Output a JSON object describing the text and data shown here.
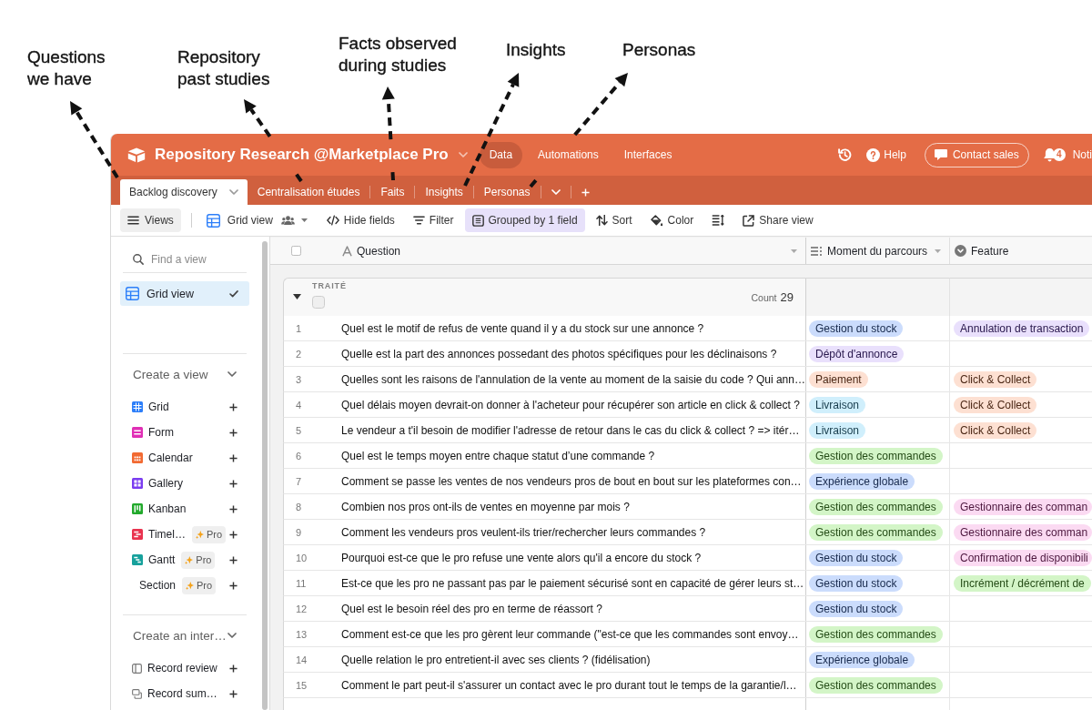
{
  "annotations": [
    {
      "text": "Questions\nwe have"
    },
    {
      "text": "Repository\npast studies"
    },
    {
      "text": "Facts observed\nduring studies"
    },
    {
      "text": "Insights"
    },
    {
      "text": "Personas"
    }
  ],
  "header": {
    "title": "Repository Research @Marketplace Pro",
    "nav": [
      {
        "label": "Data",
        "selected": true
      },
      {
        "label": "Automations",
        "selected": false
      },
      {
        "label": "Interfaces",
        "selected": false
      }
    ],
    "help": "Help",
    "contact_sales": "Contact sales",
    "notification_count": "4",
    "notifications": "Noti"
  },
  "tabs": [
    {
      "label": "Backlog discovery",
      "selected": true
    },
    {
      "label": "Centralisation études",
      "selected": false
    },
    {
      "label": "Faits",
      "selected": false
    },
    {
      "label": "Insights",
      "selected": false
    },
    {
      "label": "Personas",
      "selected": false
    }
  ],
  "toolbar": {
    "views": "Views",
    "view_name": "Grid view",
    "buttons": [
      {
        "kind": "hide",
        "label": "Hide fields",
        "active": false
      },
      {
        "kind": "filter",
        "label": "Filter",
        "active": false
      },
      {
        "kind": "group",
        "label": "Grouped by 1 field",
        "active": true
      },
      {
        "kind": "sort",
        "label": "Sort",
        "active": false
      },
      {
        "kind": "color",
        "label": "Color",
        "active": false
      },
      {
        "kind": "row_height",
        "active": false
      },
      {
        "kind": "share",
        "label": "Share view",
        "active": false
      }
    ]
  },
  "sidebar": {
    "search_placeholder": "Find a view",
    "views": [
      {
        "label": "Grid view",
        "selected": true
      }
    ],
    "sections": [
      {
        "title": "Create a view",
        "expanded": true,
        "items": [
          {
            "kind": "grid",
            "label": "Grid"
          },
          {
            "kind": "form",
            "label": "Form"
          },
          {
            "kind": "calendar",
            "label": "Calendar"
          },
          {
            "kind": "gallery",
            "label": "Gallery"
          },
          {
            "kind": "kanban",
            "label": "Kanban"
          },
          {
            "kind": "timeline",
            "label": "Timel…",
            "badge": "Pro"
          },
          {
            "kind": "gantt",
            "label": "Gantt",
            "badge": "Pro"
          },
          {
            "kind": "section",
            "label": "Section",
            "badge": "Pro"
          }
        ]
      },
      {
        "title": "Create an inter…",
        "expanded": true,
        "items": [
          {
            "kind": "record_review",
            "label": "Record review"
          },
          {
            "kind": "record_summary",
            "label": "Record sum…"
          }
        ]
      }
    ]
  },
  "table": {
    "select_all": {
      "checked": false
    },
    "columns": [
      {
        "kind": "text",
        "label": "Question"
      },
      {
        "kind": "multi_select",
        "label": "Moment du parcours"
      },
      {
        "kind": "single_select",
        "label": "Feature"
      }
    ],
    "group": {
      "field": "TRAITÉ",
      "checked": false,
      "expanded": true,
      "count_label": "Count",
      "count": "29"
    },
    "rows": [
      {
        "number": "1",
        "question": "Quel est le motif de refus de vente quand il y a du stock sur une annonce ?",
        "moment": {
          "label": "Gestion du stock",
          "color": "#cbdcfc"
        },
        "feature": {
          "label": "Annulation de transaction",
          "color": "#e9e0fc"
        }
      },
      {
        "number": "2",
        "question": "Quelle est la part des annonces possedant des photos spécifiques pour les déclinaisons ?",
        "moment": {
          "label": "Dépôt d'annonce",
          "color": "#e9e0fc"
        }
      },
      {
        "number": "3",
        "question": "Quelles sont les raisons de l'annulation de la vente au moment de la saisie du code ? Qui ann…",
        "moment": {
          "label": "Paiement",
          "color": "#fde0d2"
        },
        "feature": {
          "label": "Click & Collect",
          "color": "#fde0d2"
        }
      },
      {
        "number": "4",
        "question": "Quel délais moyen devrait-on donner à l'acheteur pour récupérer son article en click & collect ?",
        "moment": {
          "label": "Livraison",
          "color": "#d0effc"
        },
        "feature": {
          "label": "Click & Collect",
          "color": "#fde0d2"
        }
      },
      {
        "number": "5",
        "question": "Le vendeur a t'il besoin de modifier l'adresse de retour dans le cas du click & collect ? => itér…",
        "moment": {
          "label": "Livraison",
          "color": "#d0effc"
        },
        "feature": {
          "label": "Click & Collect",
          "color": "#fde0d2"
        }
      },
      {
        "number": "6",
        "question": "Quel est le temps moyen entre chaque statut d’une commande ?",
        "moment": {
          "label": "Gestion des commandes",
          "color": "#d3f5c7"
        }
      },
      {
        "number": "7",
        "question": "Comment se passe les ventes de nos vendeurs pros de bout en bout sur les plateformes con…",
        "moment": {
          "label": "Expérience globale",
          "color": "#cbdcfc"
        }
      },
      {
        "number": "8",
        "question": "Combien nos pros ont-ils de ventes en moyenne par mois ?",
        "moment": {
          "label": "Gestion des commandes",
          "color": "#d3f5c7"
        },
        "feature": {
          "label": "Gestionnaire des comman",
          "color": "#fbdaf2"
        }
      },
      {
        "number": "9",
        "question": "Comment les vendeurs pros veulent-ils trier/rechercher leurs commandes ?",
        "moment": {
          "label": "Gestion des commandes",
          "color": "#d3f5c7"
        },
        "feature": {
          "label": "Gestionnaire des comman",
          "color": "#fbdaf2"
        }
      },
      {
        "number": "10",
        "question": "Pourquoi est-ce que le pro refuse une vente alors qu'il a encore du stock ?",
        "moment": {
          "label": "Gestion du stock",
          "color": "#cbdcfc"
        },
        "feature": {
          "label": "Confirmation de disponibili",
          "color": "#fbdaf2"
        }
      },
      {
        "number": "11",
        "question": "Est-ce que les pro ne passant pas par le paiement sécurisé sont en capacité de gérer leurs st…",
        "moment": {
          "label": "Gestion du stock",
          "color": "#cbdcfc"
        },
        "feature": {
          "label": "Incrément / décrément de",
          "color": "#d3f5c7"
        }
      },
      {
        "number": "12",
        "question": "Quel est le besoin réel des pro en terme de réassort ?",
        "moment": {
          "label": "Gestion du stock",
          "color": "#cbdcfc"
        }
      },
      {
        "number": "13",
        "question": "Comment est-ce que les pro gèrent leur commande (\"est-ce que les commandes sont envoy…",
        "moment": {
          "label": "Gestion des commandes",
          "color": "#d3f5c7"
        }
      },
      {
        "number": "14",
        "question": "Quelle relation le pro entretient-il avec ses clients ? (fidélisation)",
        "moment": {
          "label": "Expérience globale",
          "color": "#cbdcfc"
        }
      },
      {
        "number": "15",
        "question": "Comment le part peut-il s'assurer un contact avec le pro durant tout le temps de la garantie/l…",
        "moment": {
          "label": "Gestion des commandes",
          "color": "#d3f5c7"
        }
      }
    ]
  }
}
